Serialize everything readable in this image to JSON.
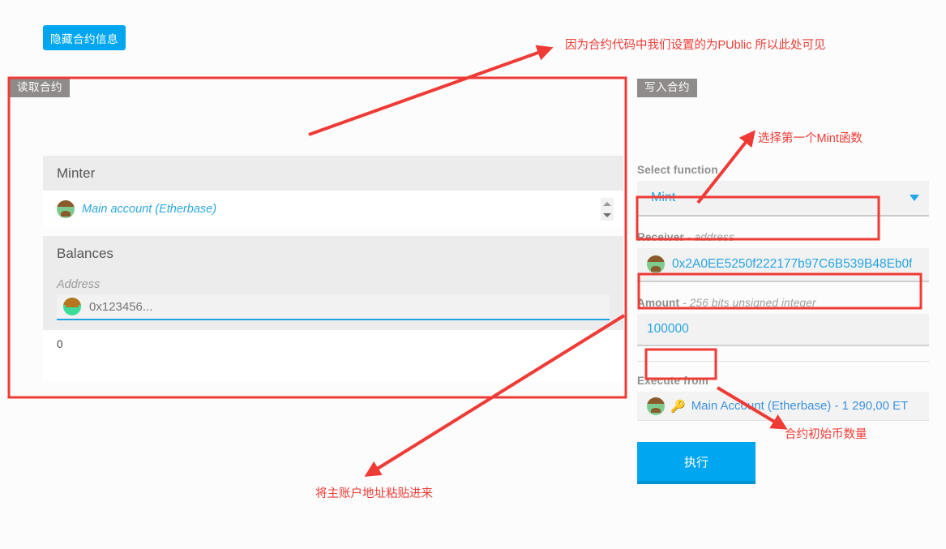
{
  "toolbar": {
    "hide_contract_label": "隐藏合约信息"
  },
  "read_contract": {
    "tab_label": "读取合约",
    "minter": {
      "header": "Minter",
      "account_label": "Main account (Etherbase)",
      "avatar": "blockie-avatar-icon",
      "stepper": "spinner-stepper-icon"
    },
    "balances": {
      "header": "Balances",
      "address_label": "Address",
      "address_placeholder": "0x123456...",
      "address_value": "",
      "result_value": "0"
    }
  },
  "write_contract": {
    "tab_label": "写入合约",
    "select_function": {
      "label": "Select function",
      "selected": "Mint"
    },
    "receiver": {
      "label": "Receiver",
      "type_hint": "- address",
      "value": "0x2A0EE5250f222177b97C6B539B48Eb0f"
    },
    "amount": {
      "label": "Amount",
      "type_hint": "- 256 bits unsigned integer",
      "value": "100000"
    },
    "execute_from": {
      "label": "Execute from",
      "account": "Main Account (Etherbase) - 1 290,00 ET"
    },
    "execute_button_label": "执行"
  },
  "annotations": {
    "public_note": "因为合约代码中我们设置的为PUblic 所以此处可见",
    "select_mint_note": "选择第一个Mint函数",
    "paste_address_note": "将主账户地址粘贴进来",
    "initial_supply_note": "合约初始币数量"
  },
  "colors": {
    "accent_blue": "#00a7f0",
    "link_blue": "#29a4e3",
    "annotation_red": "#ef3b36",
    "tab_gray": "#908b8b"
  }
}
